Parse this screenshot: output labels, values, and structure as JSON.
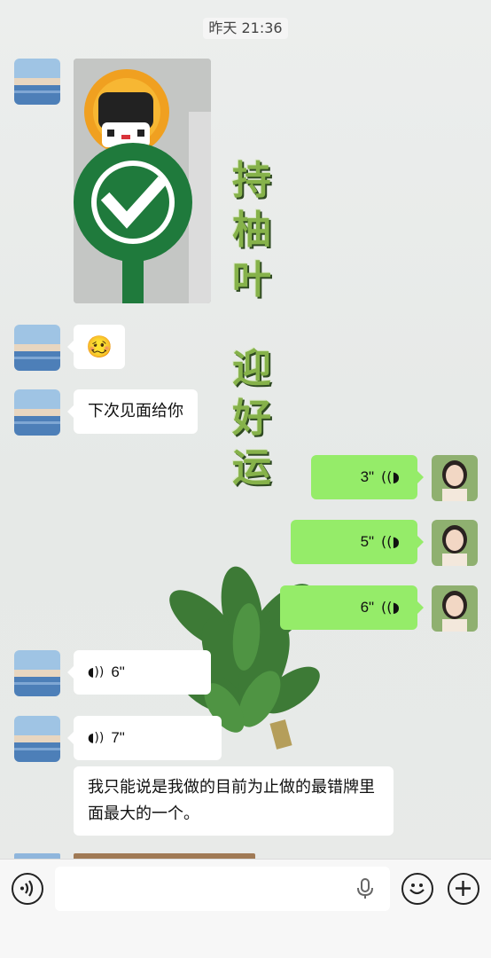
{
  "timestamp": "昨天 21:36",
  "messages": {
    "photo_alt": "持柚叶迎好运拼豆牌照片",
    "emoji": "🥴",
    "text1": "下次见面给你",
    "out_voice1": "3\"",
    "out_voice2": "5\"",
    "out_voice3": "6\"",
    "in_voice1": "6\"",
    "in_voice2": "7\"",
    "text2": "我只能说是我做的目前为止做的最错牌里面最大的一个。"
  },
  "decoration": {
    "line1": [
      "持",
      "柚",
      "叶"
    ],
    "line2": [
      "迎",
      "好",
      "运"
    ]
  },
  "input_bar": {
    "voice_icon": "voice-mode-icon",
    "mic_icon": "microphone-icon",
    "emoji_icon": "emoji-smile-icon",
    "plus_icon": "plus-icon",
    "input_value": ""
  },
  "colors": {
    "outgoing_bubble": "#95ec69",
    "incoming_bubble": "#ffffff",
    "decoration_green": "#86b24a"
  }
}
